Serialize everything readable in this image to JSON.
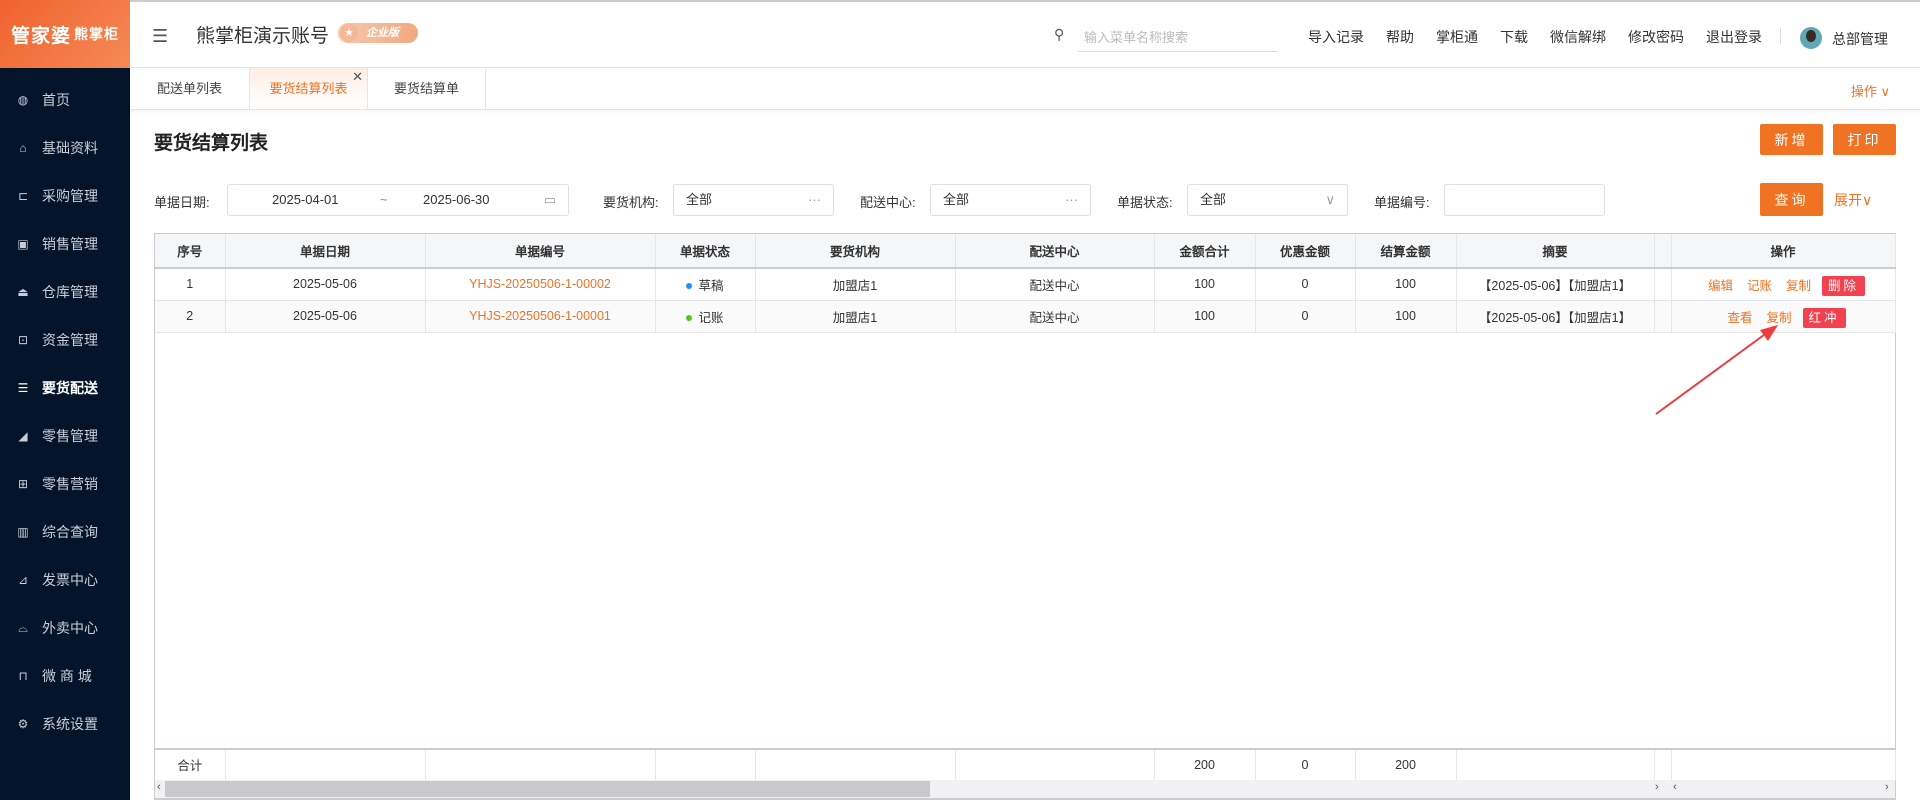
{
  "logo": {
    "main": "管家婆",
    "sub": "熊掌柜"
  },
  "sidebar": [
    {
      "icon": "globe-icon",
      "g": "◍",
      "label": "首页"
    },
    {
      "icon": "home-icon",
      "g": "⌂",
      "label": "基础资料"
    },
    {
      "icon": "cart-icon",
      "g": "⊏",
      "label": "采购管理"
    },
    {
      "icon": "calendar-icon",
      "g": "▣",
      "label": "销售管理"
    },
    {
      "icon": "bank-icon",
      "g": "⏏",
      "label": "仓库管理"
    },
    {
      "icon": "money-icon",
      "g": "⊡",
      "label": "资金管理"
    },
    {
      "icon": "list-icon",
      "g": "☰",
      "label": "要货配送"
    },
    {
      "icon": "area-chart-icon",
      "g": "◢",
      "label": "零售管理"
    },
    {
      "icon": "gift-icon",
      "g": "⊞",
      "label": "零售营销"
    },
    {
      "icon": "bar-chart-icon",
      "g": "▥",
      "label": "综合查询"
    },
    {
      "icon": "line-chart-icon",
      "g": "⊿",
      "label": "发票中心"
    },
    {
      "icon": "bell-icon",
      "g": "⌓",
      "label": "外卖中心"
    },
    {
      "icon": "bag-icon",
      "g": "⊓",
      "label": "微 商 城"
    },
    {
      "icon": "gear-icon",
      "g": "⚙",
      "label": "系统设置"
    }
  ],
  "sidebar_active": 6,
  "header": {
    "account": "熊掌柜演示账号",
    "edition": "企业版",
    "search_placeholder": "输入菜单名称搜索",
    "links": [
      "导入记录",
      "帮助",
      "掌柜通",
      "下载",
      "微信解绑",
      "修改密码",
      "退出登录"
    ],
    "user": "总部管理"
  },
  "tabs": [
    "配送单列表",
    "要货结算列表",
    "要货结算单"
  ],
  "tabs_ops": "操作 ∨",
  "page": {
    "title": "要货结算列表",
    "new": "新增",
    "print": "打印"
  },
  "filters": {
    "date_label": "单据日期:",
    "date_from": "2025-04-01",
    "date_sep": "~",
    "date_to": "2025-06-30",
    "org_label": "要货机构:",
    "org": "全部",
    "center_label": "配送中心:",
    "center": "全部",
    "status_label": "单据状态:",
    "status": "全部",
    "code_label": "单据编号:",
    "code": "",
    "query": "查询",
    "expand": "展开∨"
  },
  "table": {
    "headers": [
      "序号",
      "单据日期",
      "单据编号",
      "单据状态",
      "要货机构",
      "配送中心",
      "金额合计",
      "优惠金额",
      "结算金额",
      "摘要",
      "",
      "操作"
    ],
    "rows": [
      {
        "no": "1",
        "date": "2025-05-06",
        "code": "YHJS-20250506-1-00002",
        "status": "草稿",
        "status_color": "#1e90ff",
        "org": "加盟店1",
        "center": "配送中心",
        "amount": "100",
        "discount": "0",
        "settle": "100",
        "summary": "【2025-05-06】【加盟店1】",
        "actions": [
          "编辑",
          "记账",
          "复制"
        ],
        "danger": "删除"
      },
      {
        "no": "2",
        "date": "2025-05-06",
        "code": "YHJS-20250506-1-00001",
        "status": "记账",
        "status_color": "#52c41a",
        "org": "加盟店1",
        "center": "配送中心",
        "amount": "100",
        "discount": "0",
        "settle": "100",
        "summary": "【2025-05-06】【加盟店1】",
        "actions": [
          "查看",
          "复制"
        ],
        "danger": "红冲"
      }
    ],
    "footer": {
      "label": "合计",
      "amount": "200",
      "discount": "0",
      "settle": "200"
    }
  },
  "colors": {
    "accent": "#f07223",
    "danger": "#f0424f",
    "sidebar": "#04152b"
  }
}
